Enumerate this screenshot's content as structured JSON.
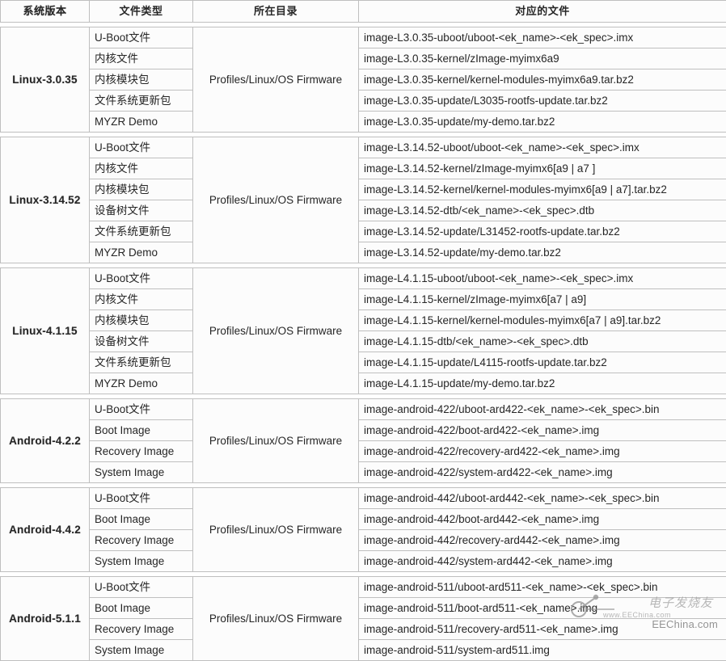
{
  "table": {
    "headers": [
      {
        "label": "系统版本",
        "style": "blue"
      },
      {
        "label": "文件类型",
        "style": "yellow"
      },
      {
        "label": "所在目录",
        "style": "yellow"
      },
      {
        "label": "对应的文件",
        "style": "yellow"
      }
    ],
    "colors": {
      "header_blue": "#0000ff",
      "header_yellow": "#ffff00",
      "version_cell_blue": "#0000ff",
      "header_blue_text": "#ffffff",
      "grid_line": "#bfbfbf",
      "cell_background": "#fcfcfc"
    },
    "groups": [
      {
        "version": "Linux-3.0.35",
        "directory": "Profiles/Linux/OS Firmware",
        "rows": [
          {
            "type": "U-Boot文件",
            "file": "image-L3.0.35-uboot/uboot-<ek_name>-<ek_spec>.imx"
          },
          {
            "type": "内核文件",
            "file": "image-L3.0.35-kernel/zImage-myimx6a9"
          },
          {
            "type": "内核模块包",
            "file": "image-L3.0.35-kernel/kernel-modules-myimx6a9.tar.bz2"
          },
          {
            "type": "文件系统更新包",
            "file": "image-L3.0.35-update/L3035-rootfs-update.tar.bz2"
          },
          {
            "type": "MYZR Demo",
            "file": "image-L3.0.35-update/my-demo.tar.bz2"
          }
        ]
      },
      {
        "version": "Linux-3.14.52",
        "directory": "Profiles/Linux/OS Firmware",
        "rows": [
          {
            "type": "U-Boot文件",
            "file": "image-L3.14.52-uboot/uboot-<ek_name>-<ek_spec>.imx"
          },
          {
            "type": "内核文件",
            "file": "image-L3.14.52-kernel/zImage-myimx6[a9 | a7 ]"
          },
          {
            "type": "内核模块包",
            "file": "image-L3.14.52-kernel/kernel-modules-myimx6[a9 | a7].tar.bz2"
          },
          {
            "type": "设备树文件",
            "file": "image-L3.14.52-dtb/<ek_name>-<ek_spec>.dtb"
          },
          {
            "type": "文件系统更新包",
            "file": "image-L3.14.52-update/L31452-rootfs-update.tar.bz2"
          },
          {
            "type": "MYZR Demo",
            "file": "image-L3.14.52-update/my-demo.tar.bz2"
          }
        ]
      },
      {
        "version": "Linux-4.1.15",
        "directory": "Profiles/Linux/OS Firmware",
        "rows": [
          {
            "type": "U-Boot文件",
            "file": "image-L4.1.15-uboot/uboot-<ek_name>-<ek_spec>.imx"
          },
          {
            "type": "内核文件",
            "file": "image-L4.1.15-kernel/zImage-myimx6[a7 | a9]"
          },
          {
            "type": "内核模块包",
            "file": "image-L4.1.15-kernel/kernel-modules-myimx6[a7 | a9].tar.bz2"
          },
          {
            "type": "设备树文件",
            "file": "image-L4.1.15-dtb/<ek_name>-<ek_spec>.dtb"
          },
          {
            "type": "文件系统更新包",
            "file": "image-L4.1.15-update/L4115-rootfs-update.tar.bz2"
          },
          {
            "type": "MYZR Demo",
            "file": "image-L4.1.15-update/my-demo.tar.bz2"
          }
        ]
      },
      {
        "version": "Android-4.2.2",
        "directory": "Profiles/Linux/OS Firmware",
        "rows": [
          {
            "type": "U-Boot文件",
            "file": "image-android-422/uboot-ard422-<ek_name>-<ek_spec>.bin"
          },
          {
            "type": "Boot Image",
            "file": "image-android-422/boot-ard422-<ek_name>.img"
          },
          {
            "type": "Recovery Image",
            "file": "image-android-422/recovery-ard422-<ek_name>.img"
          },
          {
            "type": "System Image",
            "file": "image-android-422/system-ard422-<ek_name>.img"
          }
        ]
      },
      {
        "version": "Android-4.4.2",
        "directory": "Profiles/Linux/OS Firmware",
        "rows": [
          {
            "type": "U-Boot文件",
            "file": "image-android-442/uboot-ard442-<ek_name>-<ek_spec>.bin"
          },
          {
            "type": "Boot Image",
            "file": "image-android-442/boot-ard442-<ek_name>.img"
          },
          {
            "type": "Recovery Image",
            "file": "image-android-442/recovery-ard442-<ek_name>.img"
          },
          {
            "type": "System Image",
            "file": "image-android-442/system-ard442-<ek_name>.img"
          }
        ]
      },
      {
        "version": "Android-5.1.1",
        "directory": "Profiles/Linux/OS Firmware",
        "rows": [
          {
            "type": "U-Boot文件",
            "file": "image-android-511/uboot-ard511-<ek_name>-<ek_spec>.bin"
          },
          {
            "type": "Boot Image",
            "file": "image-android-511/boot-ard511-<ek_name>.img"
          },
          {
            "type": "Recovery Image",
            "file": "image-android-511/recovery-ard511-<ek_name>.img"
          },
          {
            "type": "System Image",
            "file": "image-android-511/system-ard511.img"
          }
        ]
      }
    ]
  },
  "watermark": {
    "site": "EEChina.com",
    "site_sub": "www.EEChina.com",
    "brand_cn": "电子发烧友"
  }
}
